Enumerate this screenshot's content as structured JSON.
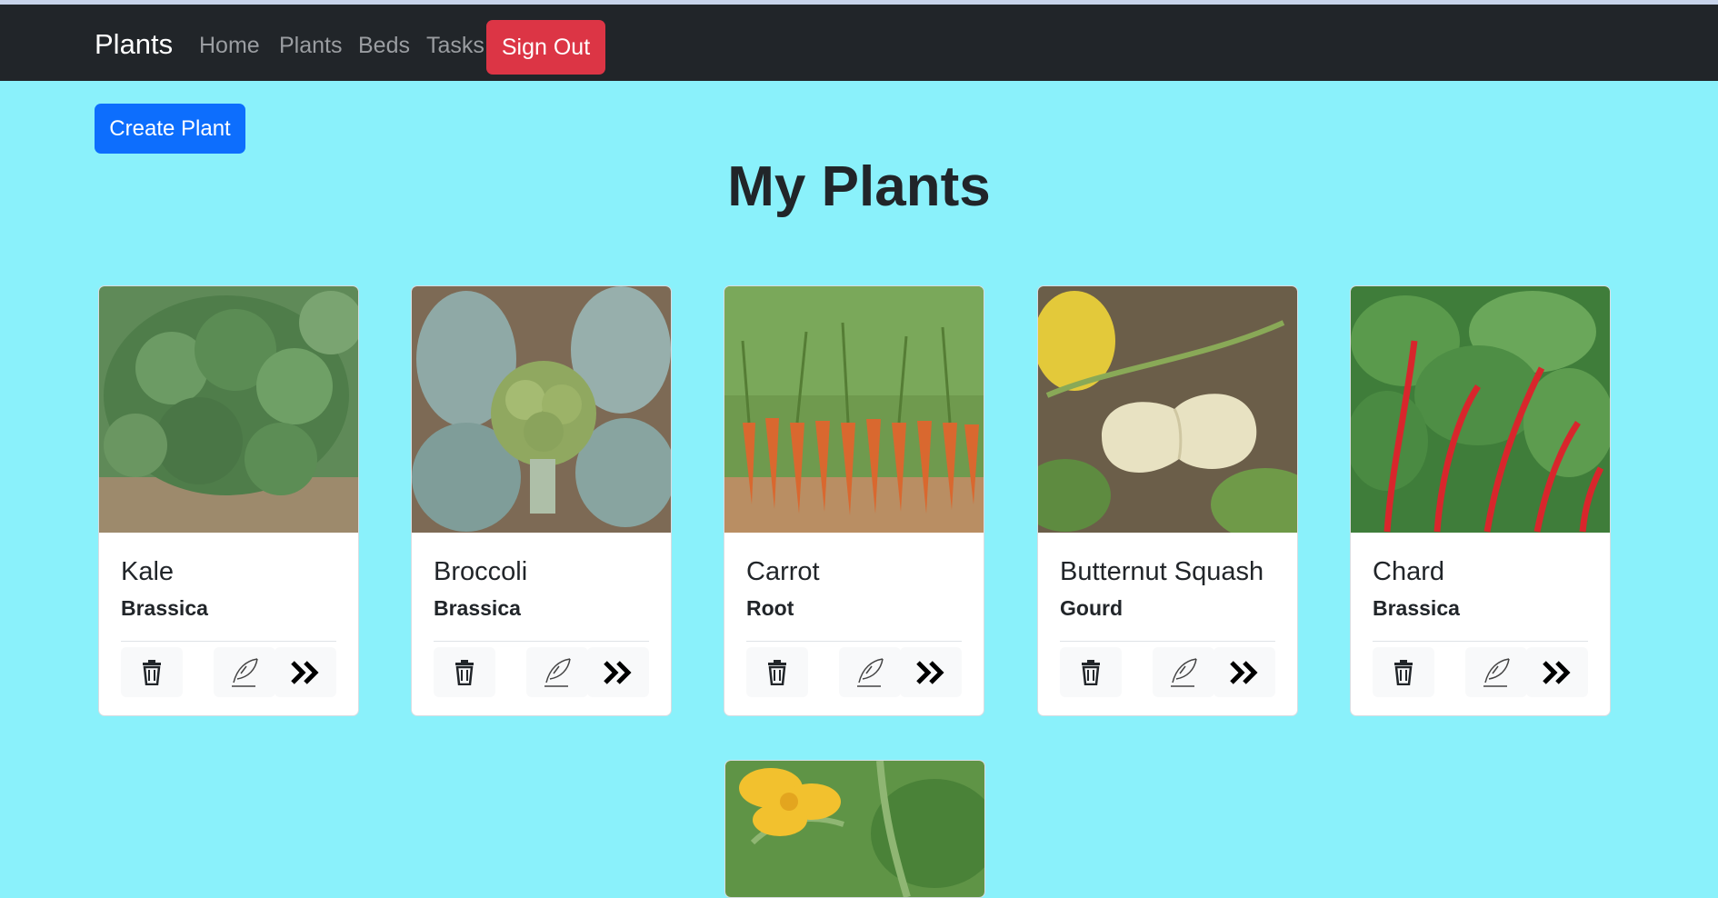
{
  "nav": {
    "brand": "Plants",
    "links": [
      "Home",
      "Plants",
      "Beds",
      "Tasks"
    ],
    "signout": "Sign Out"
  },
  "toolbar": {
    "create_label": "Create Plant"
  },
  "page": {
    "title": "My Plants"
  },
  "icons": {
    "delete": "trash-icon",
    "edit": "quill-pen-icon",
    "details": "double-chevron-right-icon"
  },
  "cards": [
    {
      "name": "Kale",
      "family": "Brassica"
    },
    {
      "name": "Broccoli",
      "family": "Brassica"
    },
    {
      "name": "Carrot",
      "family": "Root"
    },
    {
      "name": "Butternut Squash",
      "family": "Gourd"
    },
    {
      "name": "Chard",
      "family": "Brassica"
    }
  ],
  "colors": {
    "background": "#8af1fb",
    "navbar": "#212529",
    "signout": "#dc3545",
    "primary": "#0d6efd"
  }
}
